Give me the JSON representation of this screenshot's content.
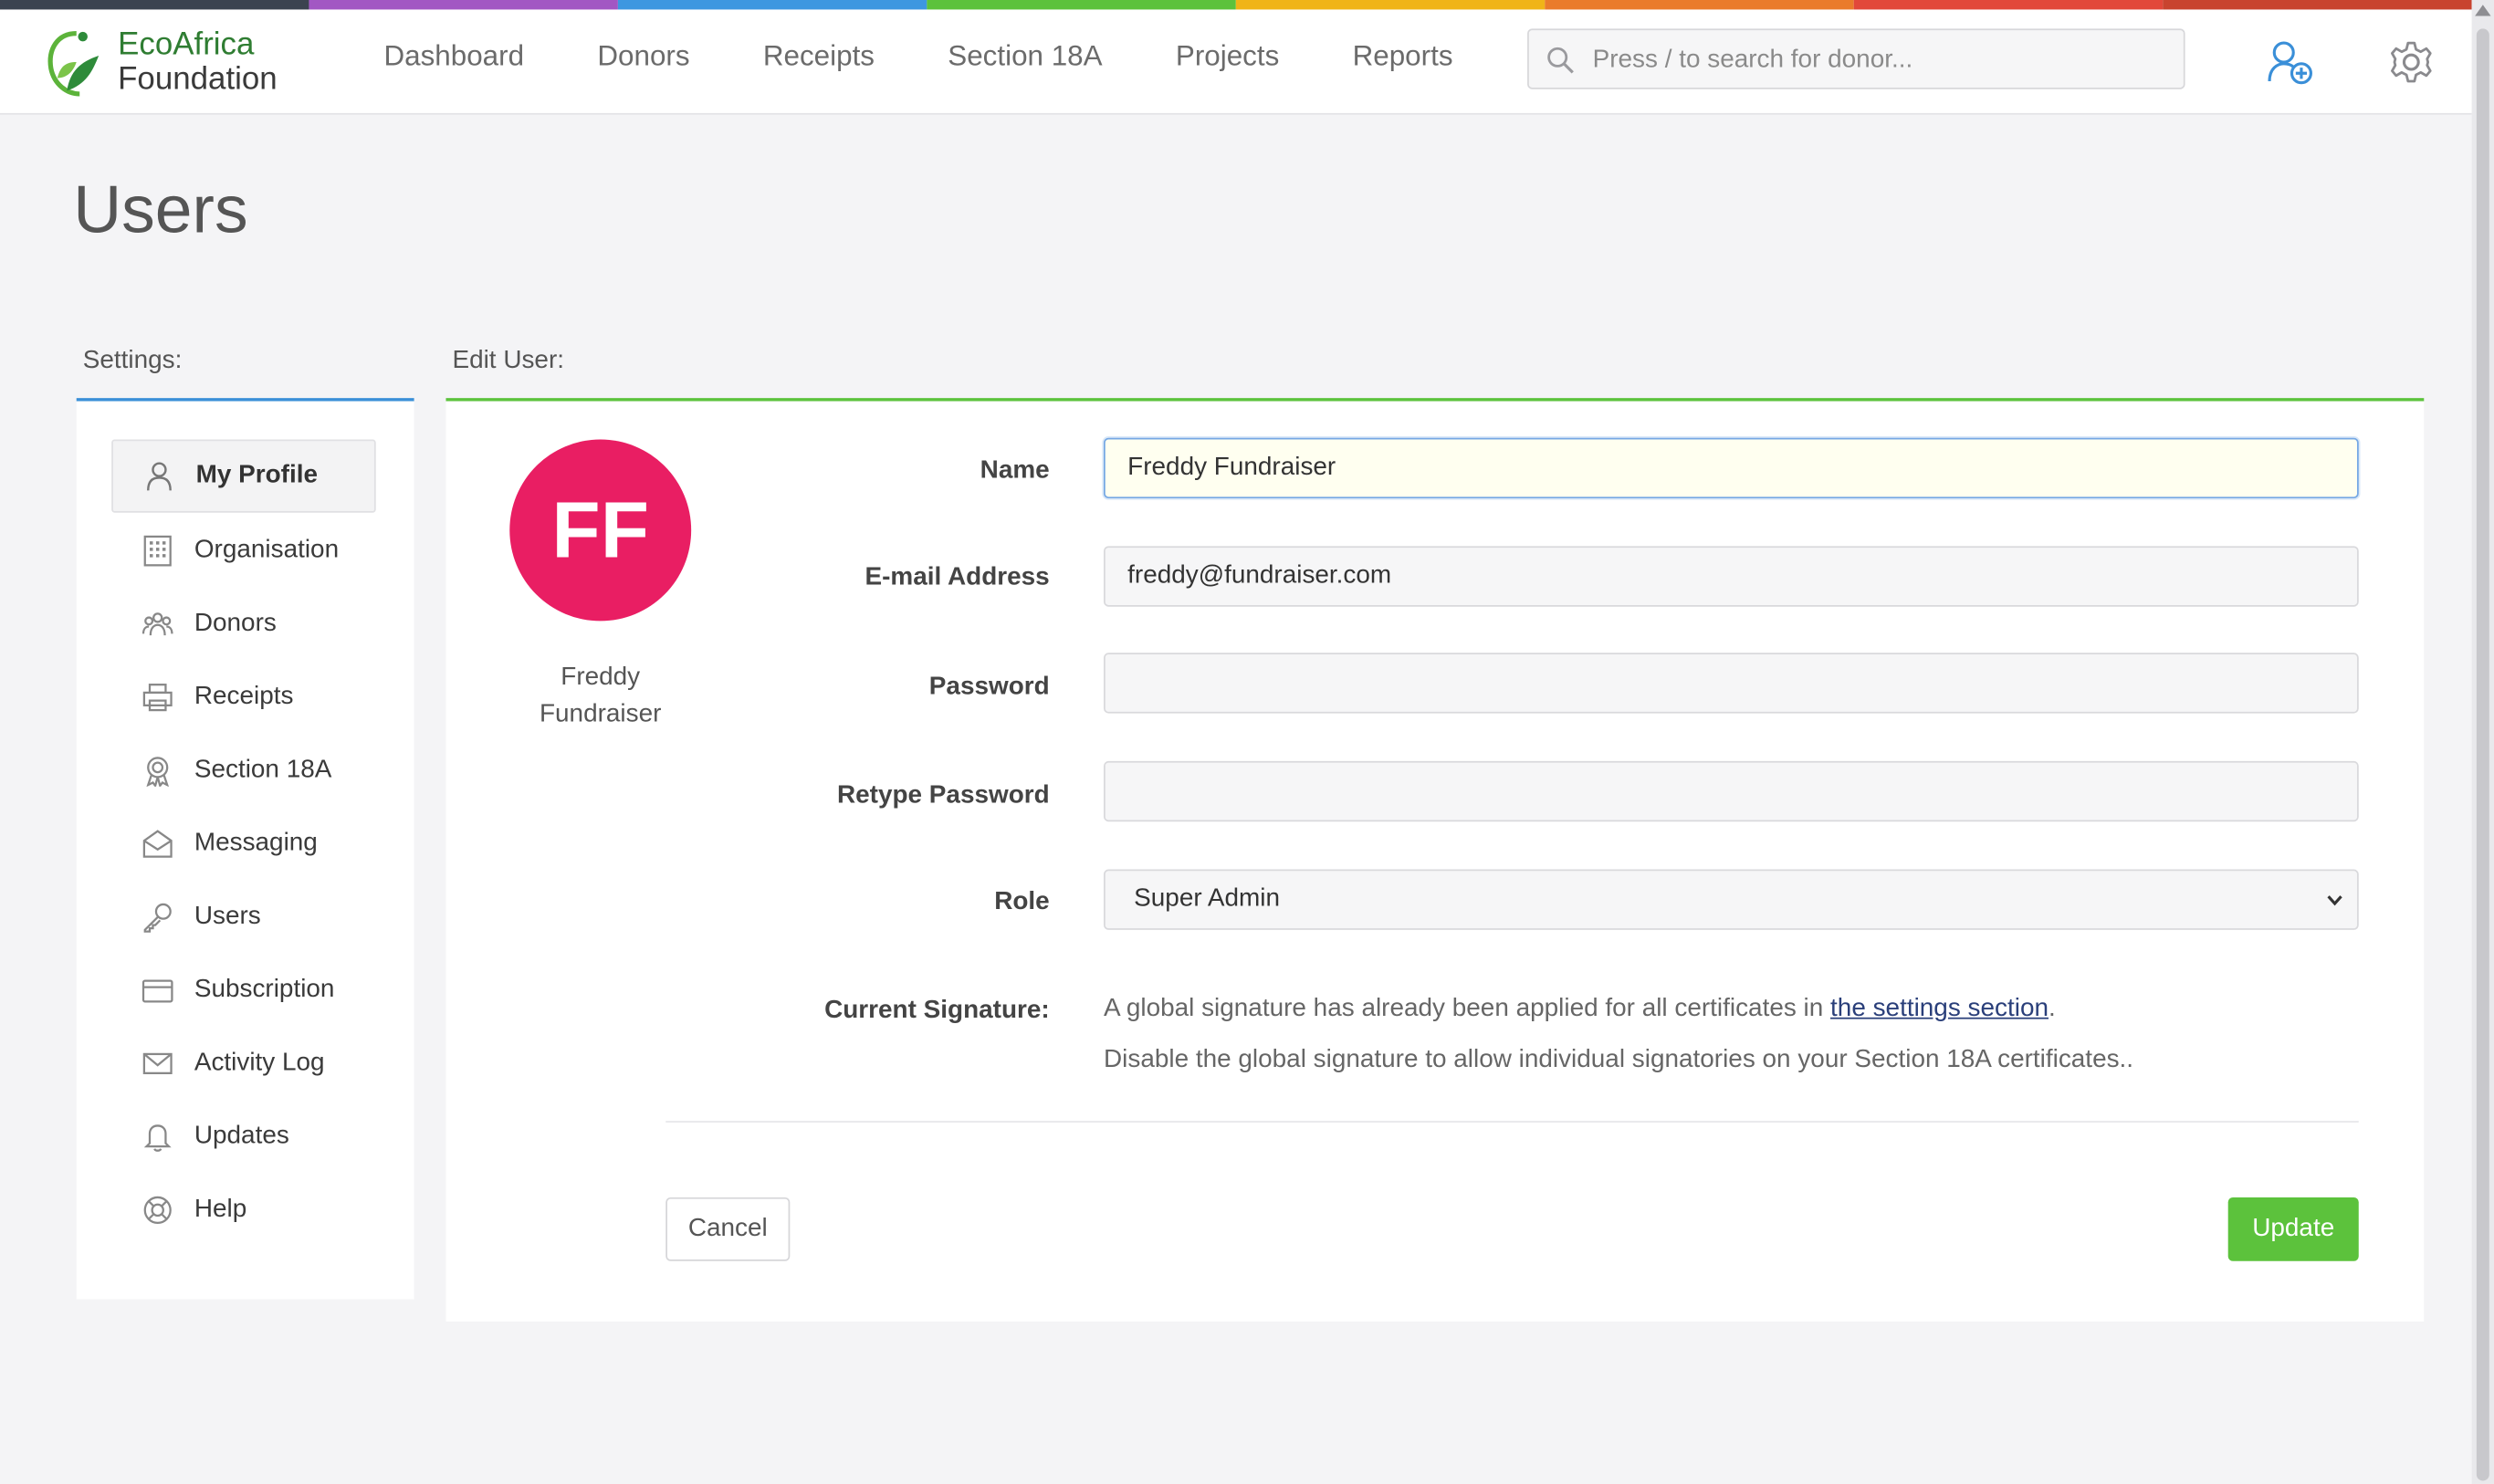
{
  "brand": {
    "line1": "EcoAfrica",
    "line2": "Foundation"
  },
  "colors": {
    "rainbow": [
      "#3b4350",
      "#a257c3",
      "#3d97e0",
      "#5cc23c",
      "#f0b418",
      "#ea7b2b",
      "#e2483a",
      "#c8442f"
    ],
    "accent_green": "#5cc23c",
    "accent_blue": "#3a8fd8",
    "avatar": "#e91e63"
  },
  "nav": [
    "Dashboard",
    "Donors",
    "Receipts",
    "Section 18A",
    "Projects",
    "Reports"
  ],
  "search": {
    "placeholder": "Press / to search for donor..."
  },
  "icons": {
    "topbar": [
      "add-user-icon",
      "gear-icon"
    ]
  },
  "page": {
    "title": "Users"
  },
  "settings": {
    "heading": "Settings:",
    "items": [
      {
        "label": "My Profile",
        "icon": "user-icon",
        "active": true
      },
      {
        "label": "Organisation",
        "icon": "building-icon"
      },
      {
        "label": "Donors",
        "icon": "group-icon"
      },
      {
        "label": "Receipts",
        "icon": "printer-icon"
      },
      {
        "label": "Section 18A",
        "icon": "award-icon"
      },
      {
        "label": "Messaging",
        "icon": "envelope-open-icon"
      },
      {
        "label": "Users",
        "icon": "key-icon"
      },
      {
        "label": "Subscription",
        "icon": "card-icon"
      },
      {
        "label": "Activity Log",
        "icon": "envelope-icon"
      },
      {
        "label": "Updates",
        "icon": "bell-icon"
      },
      {
        "label": "Help",
        "icon": "lifebuoy-icon"
      }
    ]
  },
  "edit": {
    "heading": "Edit User:",
    "avatar_initials": "FF",
    "avatar_name_line1": "Freddy",
    "avatar_name_line2": "Fundraiser",
    "labels": {
      "name": "Name",
      "email": "E-mail Address",
      "password": "Password",
      "retype": "Retype Password",
      "role": "Role",
      "signature": "Current Signature:"
    },
    "values": {
      "name": "Freddy Fundraiser",
      "email": "freddy@fundraiser.com",
      "password": "",
      "retype": "",
      "role": "Super Admin"
    },
    "signature": {
      "line1_before": "A global signature has already been applied for all certificates in ",
      "line1_link": "the settings section",
      "line1_after": ".",
      "line2": "Disable the global signature to allow individual signatories on your Section 18A certificates.."
    },
    "cancel": "Cancel",
    "update": "Update"
  }
}
